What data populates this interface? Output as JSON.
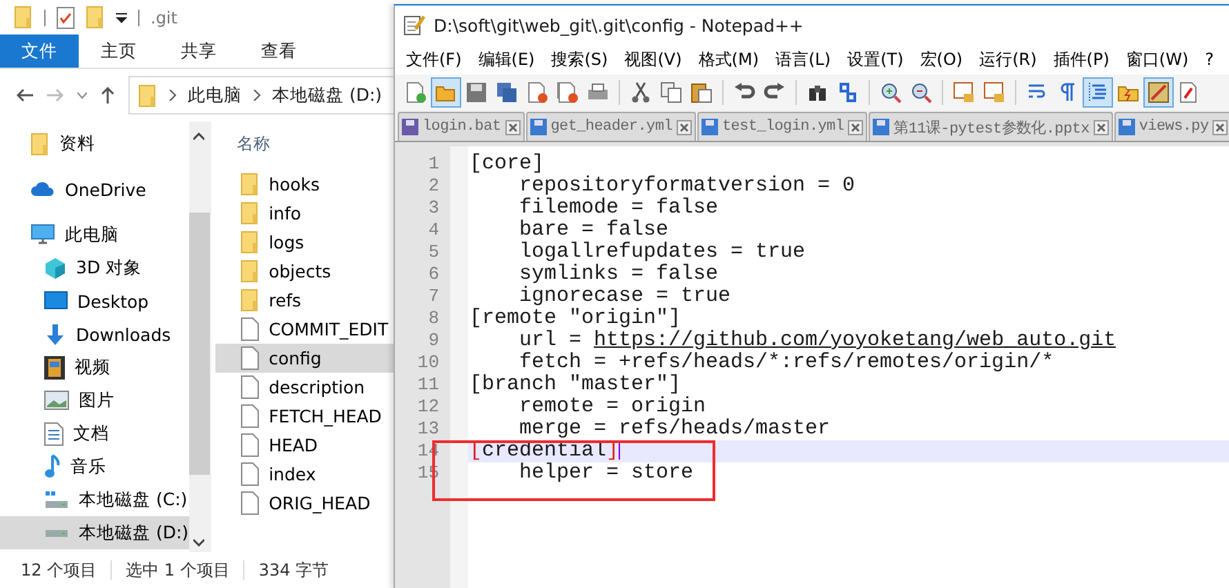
{
  "explorer": {
    "title": ".git",
    "ribbon_tabs": [
      {
        "label": "文件",
        "kind": "file-menu"
      },
      {
        "label": "主页",
        "kind": "tab"
      },
      {
        "label": "共享",
        "kind": "tab"
      },
      {
        "label": "查看",
        "kind": "tab"
      }
    ],
    "address": [
      "此电脑",
      "本地磁盘 (D:)"
    ],
    "nav_items": [
      {
        "label": "资料",
        "kind": "folder",
        "selected": false
      },
      {
        "label": "OneDrive",
        "kind": "cloud",
        "selected": false
      },
      {
        "label": "此电脑",
        "kind": "pc",
        "selected": false,
        "children": [
          {
            "label": "3D 对象",
            "kind": "cube",
            "selected": false
          },
          {
            "label": "Desktop",
            "kind": "desktop",
            "selected": false
          },
          {
            "label": "Downloads",
            "kind": "download",
            "selected": false
          },
          {
            "label": "视频",
            "kind": "video",
            "selected": false
          },
          {
            "label": "图片",
            "kind": "image",
            "selected": false
          },
          {
            "label": "文档",
            "kind": "document",
            "selected": false
          },
          {
            "label": "音乐",
            "kind": "music",
            "selected": false
          },
          {
            "label": "本地磁盘 (C:)",
            "kind": "system-drive",
            "selected": false
          },
          {
            "label": "本地磁盘 (D:)",
            "kind": "drive",
            "selected": true
          }
        ]
      }
    ],
    "column_header": "名称",
    "files": [
      {
        "name": "hooks",
        "kind": "folder",
        "selected": false
      },
      {
        "name": "info",
        "kind": "folder",
        "selected": false
      },
      {
        "name": "logs",
        "kind": "folder",
        "selected": false
      },
      {
        "name": "objects",
        "kind": "folder",
        "selected": false
      },
      {
        "name": "refs",
        "kind": "folder",
        "selected": false
      },
      {
        "name": "COMMIT_EDIT",
        "kind": "file",
        "selected": false
      },
      {
        "name": "config",
        "kind": "file",
        "selected": true
      },
      {
        "name": "description",
        "kind": "file",
        "selected": false
      },
      {
        "name": "FETCH_HEAD",
        "kind": "file",
        "selected": false
      },
      {
        "name": "HEAD",
        "kind": "file",
        "selected": false
      },
      {
        "name": "index",
        "kind": "file",
        "selected": false
      },
      {
        "name": "ORIG_HEAD",
        "kind": "file",
        "selected": false
      }
    ],
    "status_bar": [
      "12 个项目",
      "选中 1 个项目",
      "334 字节"
    ]
  },
  "notepad": {
    "title": "D:\\soft\\git\\web_git\\.git\\config - Notepad++",
    "menu": [
      "文件(F)",
      "编辑(E)",
      "搜索(S)",
      "视图(V)",
      "格式(M)",
      "语言(L)",
      "设置(T)",
      "宏(O)",
      "运行(R)",
      "插件(P)",
      "窗口(W)",
      "?"
    ],
    "toolbar": [
      [
        {
          "kind": "new",
          "on": false
        },
        {
          "kind": "open",
          "on": true
        },
        {
          "kind": "save",
          "on": false
        },
        {
          "kind": "save-all",
          "on": false
        },
        {
          "kind": "close",
          "on": false
        },
        {
          "kind": "close-all",
          "on": false
        },
        {
          "kind": "print",
          "on": false
        }
      ],
      [
        {
          "kind": "cut",
          "on": false
        },
        {
          "kind": "copy",
          "on": false
        },
        {
          "kind": "paste",
          "on": false
        }
      ],
      [
        {
          "kind": "undo",
          "on": false
        },
        {
          "kind": "redo",
          "on": false
        }
      ],
      [
        {
          "kind": "find",
          "on": false
        },
        {
          "kind": "replace",
          "on": false
        }
      ],
      [
        {
          "kind": "zoom-in",
          "on": false
        },
        {
          "kind": "zoom-out",
          "on": false
        }
      ],
      [
        {
          "kind": "sync-v",
          "on": false
        },
        {
          "kind": "sync-h",
          "on": false
        }
      ],
      [
        {
          "kind": "wrap",
          "on": false
        },
        {
          "kind": "pilcrow",
          "on": false
        },
        {
          "kind": "indent",
          "on": true
        },
        {
          "kind": "folder",
          "on": false
        },
        {
          "kind": "map",
          "on": true
        },
        {
          "kind": "function",
          "on": false
        }
      ]
    ],
    "tabs": [
      {
        "label": "login.bat",
        "modified": true,
        "selected": false
      },
      {
        "label": "get_header.yml",
        "modified": false,
        "selected": false
      },
      {
        "label": "test_login.yml",
        "modified": false,
        "selected": false
      },
      {
        "label": "第11课-pytest参数化.pptx",
        "modified": false,
        "selected": false
      },
      {
        "label": "views.py",
        "modified": false,
        "selected": false
      }
    ],
    "lines": [
      {
        "number": "1",
        "text": "[core]",
        "current": false
      },
      {
        "number": "2",
        "text": "    repositoryformatversion = 0",
        "current": false
      },
      {
        "number": "3",
        "text": "    filemode = false",
        "current": false
      },
      {
        "number": "4",
        "text": "    bare = false",
        "current": false
      },
      {
        "number": "5",
        "text": "    logallrefupdates = true",
        "current": false
      },
      {
        "number": "6",
        "text": "    symlinks = false",
        "current": false
      },
      {
        "number": "7",
        "text": "    ignorecase = true",
        "current": false
      },
      {
        "number": "8",
        "text": "[remote \"origin\"]",
        "current": false
      },
      {
        "number": "9",
        "text": "    url = ",
        "link": "https://github.com/yoyoketang/web_auto.git",
        "current": false
      },
      {
        "number": "10",
        "text": "    fetch = +refs/heads/*:refs/remotes/origin/*",
        "current": false
      },
      {
        "number": "11",
        "text": "[branch \"master\"]",
        "current": false
      },
      {
        "number": "12",
        "text": "    remote = origin",
        "current": false
      },
      {
        "number": "13",
        "text": "    merge = refs/heads/master",
        "current": false
      },
      {
        "number": "14",
        "text": "[credential]",
        "current": true,
        "brace_match": true
      },
      {
        "number": "15",
        "text": "    helper = store",
        "current": false
      }
    ]
  }
}
